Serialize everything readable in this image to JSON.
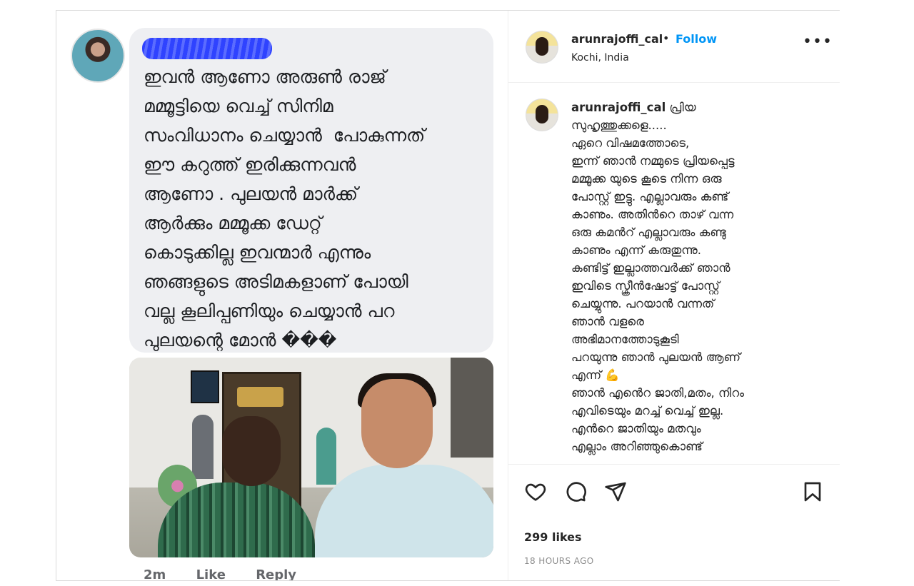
{
  "fb_comment": {
    "text_lines": [
      "ഇവൻ ആണോ അരുൺ രാജ്",
      "മമ്മൂട്ടിയെ വെച്ച് സിനിമ",
      "സംവിധാനം ചെയ്യാൻ  പോകുന്നത്",
      "ഈ കറുത്ത് ഇരിക്കുന്നവൻ",
      "ആണോ . പുലയൻ മാർക്ക്",
      "ആർക്കും മമ്മൂക്ക ഡേറ്റ്",
      "കൊടുക്കില്ല ഇവന്മാർ എന്നും",
      "ഞങ്ങളുടെ അടിമകളാണ് പോയി",
      "വല്ല കൂലിപ്പണിയും ചെയ്യാൻ പറ",
      "പുലയന്റെ മോൻ ���"
    ],
    "actions": [
      "2m",
      "Like",
      "Reply"
    ]
  },
  "post": {
    "username": "arunrajoffi_cal",
    "separator": "•",
    "follow_label": "Follow",
    "location": "Kochi, India",
    "more_label": "•••",
    "caption_username": "arunrajoffi_cal",
    "caption_lines": [
      "പ്രിയ",
      "സുഹൃത്തുക്കളെ.....",
      "ഏറെ വിഷമത്തോടെ,",
      "ഇന്ന് ഞാൻ നമ്മുടെ പ്രിയപ്പെട്ട",
      "മമ്മൂക്ക യുടെ കൂടെ നിന്ന ഒരു",
      "പോസ്റ്റ് ഇട്ടു. എല്ലാവരും കണ്ട്",
      "കാണും. അതിൻറെ താഴ് വന്ന",
      "ഒരു കമൻറ് എല്ലാവരും കണ്ടു",
      "കാണും എന്ന് കരുതുന്നു.",
      "കണ്ടിട്ട് ഇല്ലാത്തവർക്ക് ഞാൻ",
      "ഇവിടെ സ്ക്രീൻഷോട്ട് പോസ്റ്റ്",
      "ചെയ്യുന്നു. പറയാൻ വന്നത്",
      "ഞാൻ വളരെ",
      "അഭിമാനത്തോടുകൂടി",
      "പറയുന്നു ഞാൻ പുലയൻ ആണ്",
      "എന്ന് 💪",
      "ഞാൻ എൻെറ ജാതി,മതം, നിറം",
      "എവിടെയും മറച്ച് വെച്ച് ഇല്ല.",
      "എൻറെ ജാതിയും മതവും",
      "എല്ലാം അറിഞ്ഞുകൊണ്ട്"
    ],
    "likes": "299 likes",
    "time": "18 HOURS AGO"
  },
  "icons": {
    "like": "heart-icon",
    "comment": "comment-icon",
    "share": "share-icon",
    "save": "bookmark-icon"
  },
  "colors": {
    "follow": "#0095f6",
    "bubble": "#eeeff2",
    "redaction": "#2f43ff"
  }
}
